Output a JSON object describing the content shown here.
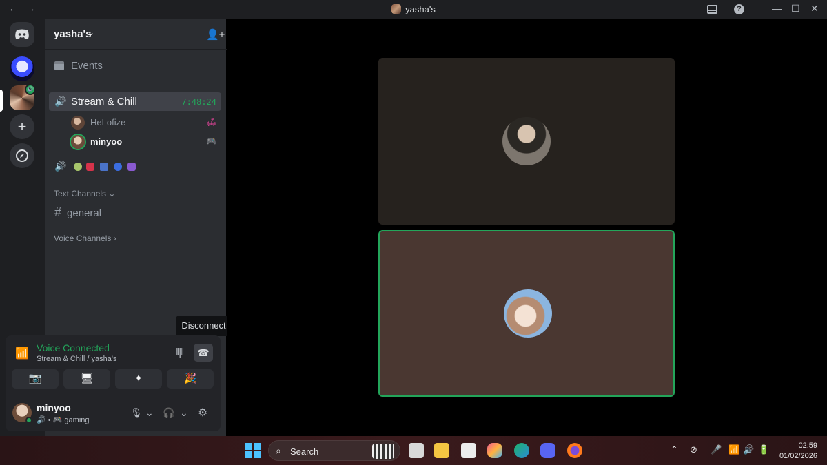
{
  "titlebar": {
    "title": "yasha's",
    "back": "←",
    "forward": "→"
  },
  "guilds": {
    "home_icon": "discord-icon",
    "add_symbol": "+"
  },
  "server": {
    "name": "yasha's",
    "events_label": "Events",
    "active_voice": {
      "name": "Stream & Chill",
      "timer": "7:48:24"
    },
    "members": [
      {
        "name": "HeLofize",
        "activity_icon": "couch-icon"
      },
      {
        "name": "minyoo",
        "activity_icon": "gamepad-icon"
      }
    ],
    "second_voice_emojis": [
      "🍈",
      "🎀",
      "🖼",
      "🌀",
      "🏄"
    ],
    "text_category": "Text Channels",
    "text_channels": [
      {
        "name": "general"
      }
    ],
    "voice_category": "Voice Channels"
  },
  "tooltip": {
    "label": "Disconnect"
  },
  "voice_panel": {
    "status": "Voice Connected",
    "subtitle": "Stream & Chill / yasha's"
  },
  "user": {
    "name": "minyoo",
    "status": "gaming"
  },
  "taskbar": {
    "search_label": "Search",
    "time": "02:59",
    "date": "01/02/2026"
  },
  "colors": {
    "accent_green": "#23a55a",
    "blurple": "#5865f2",
    "sidebar": "#2b2d31",
    "rail": "#1e1f22"
  }
}
